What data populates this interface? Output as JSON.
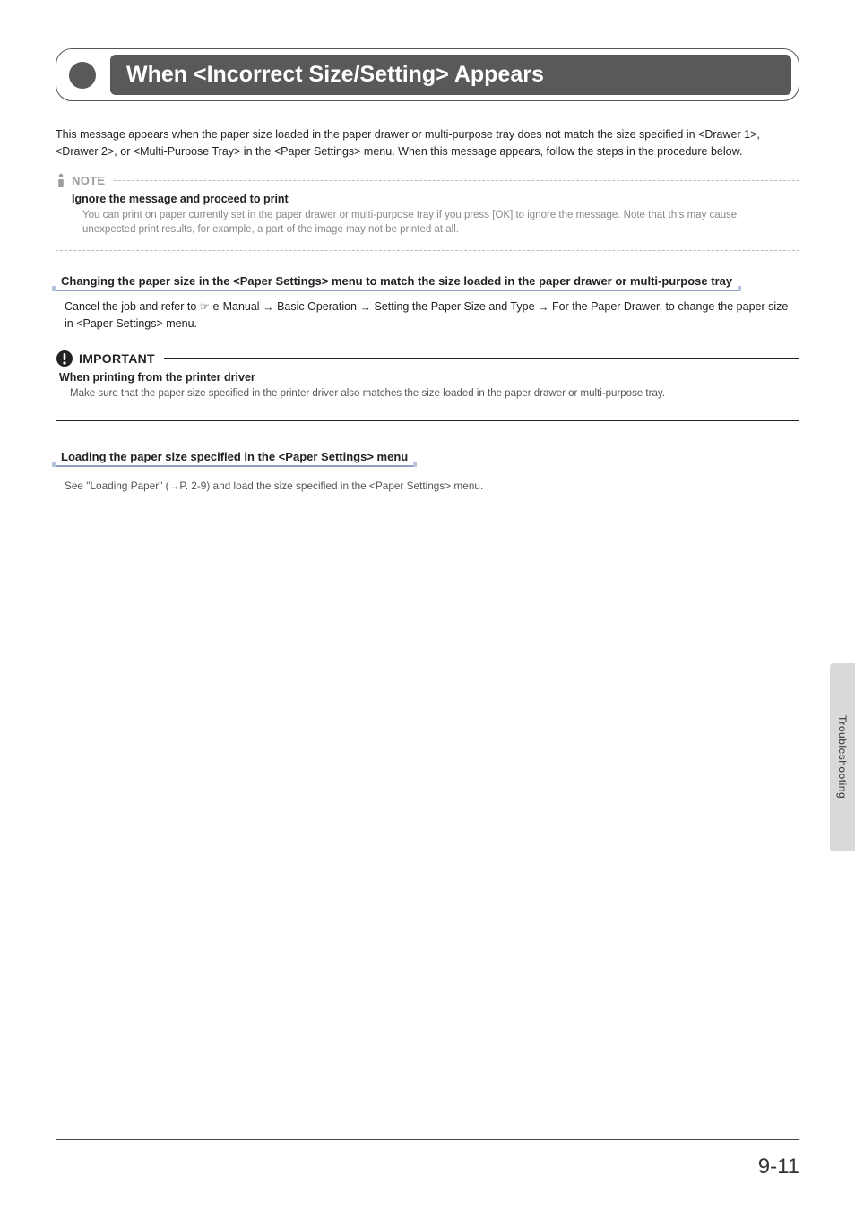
{
  "title": "When <Incorrect Size/Setting> Appears",
  "intro": "This message appears when the paper size loaded in the paper drawer or multi-purpose tray does not match the size specified in <Drawer 1>, <Drawer 2>, or <Multi-Purpose Tray> in the <Paper Settings> menu. When this message appears, follow the steps in the procedure below.",
  "note": {
    "label": "NOTE",
    "heading": "Ignore the message and proceed to print",
    "body": "You can print on paper currently set in the paper drawer or multi-purpose tray if you press [OK] to ignore the message. Note that this may cause unexpected print results, for example, a part of the image may not be printed at all."
  },
  "section1": {
    "heading": "Changing the paper size in the <Paper Settings> menu to match the size loaded in the paper drawer or multi-purpose tray",
    "body_prefix": "Cancel the job and refer to ",
    "body_ref": "☞ e-Manual",
    "body_chain": [
      "Basic Operation",
      "Setting the Paper Size and Type",
      "For the Paper Drawer"
    ],
    "body_suffix": ", to change the paper size in <Paper Settings> menu."
  },
  "important": {
    "label": "IMPORTANT",
    "heading": "When printing from the printer driver",
    "body": "Make sure that the paper size specified in the printer driver also matches the size loaded in the paper drawer or multi-purpose tray."
  },
  "section2": {
    "heading": "Loading the paper size specified in the <Paper Settings> menu",
    "body": "See \"Loading Paper\" (→P. 2-9) and load the size specified in the <Paper Settings> menu."
  },
  "side_tab": "Troubleshooting",
  "page_number": "9-11",
  "arrow": "→"
}
